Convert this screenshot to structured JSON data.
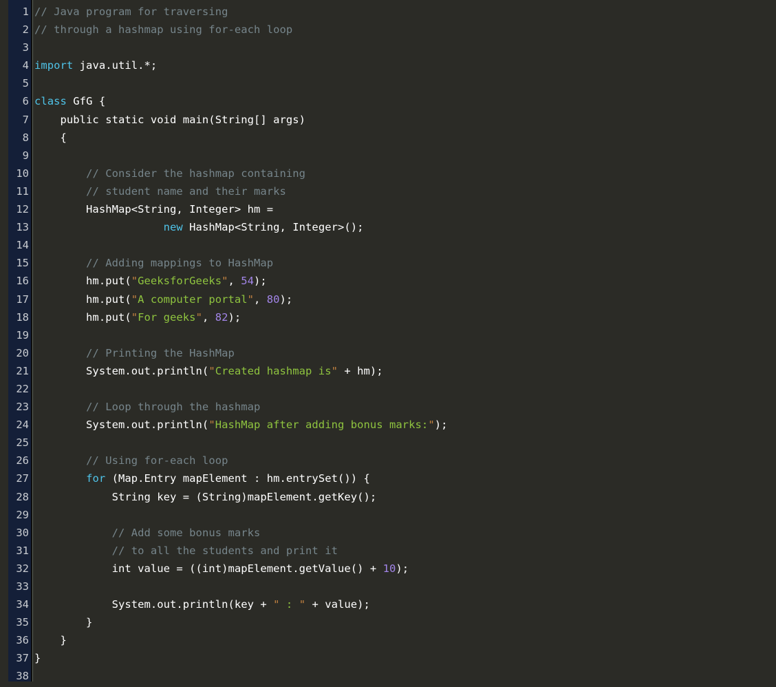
{
  "editor": {
    "language": "java",
    "total_lines": 38,
    "theme": {
      "background": "#2b2b26",
      "gutter_background": "#141f38",
      "gutter_text": "#c9ccd1",
      "plain_text": "#ffffff",
      "comment": "#76858b",
      "keyword": "#4fc3e8",
      "string": "#8fc43f",
      "quote": "#c08040",
      "number": "#a285e8"
    }
  },
  "lines": [
    {
      "n": "1",
      "tokens": [
        {
          "t": "// Java program for traversing",
          "c": "cm"
        }
      ]
    },
    {
      "n": "2",
      "tokens": [
        {
          "t": "// through a hashmap using for-each loop",
          "c": "cm"
        }
      ]
    },
    {
      "n": "3",
      "tokens": []
    },
    {
      "n": "4",
      "tokens": [
        {
          "t": "import",
          "c": "kw"
        },
        {
          "t": " java.util.*;",
          "c": "pl"
        }
      ]
    },
    {
      "n": "5",
      "tokens": []
    },
    {
      "n": "6",
      "tokens": [
        {
          "t": "class",
          "c": "kw"
        },
        {
          "t": " GfG {",
          "c": "pl"
        }
      ]
    },
    {
      "n": "7",
      "tokens": [
        {
          "t": "    public static void main(String[] args)",
          "c": "pl"
        }
      ]
    },
    {
      "n": "8",
      "tokens": [
        {
          "t": "    {",
          "c": "pl"
        }
      ]
    },
    {
      "n": "9",
      "tokens": []
    },
    {
      "n": "10",
      "tokens": [
        {
          "t": "        ",
          "c": "pl"
        },
        {
          "t": "// Consider the hashmap containing",
          "c": "cm"
        }
      ]
    },
    {
      "n": "11",
      "tokens": [
        {
          "t": "        ",
          "c": "pl"
        },
        {
          "t": "// student name and their marks",
          "c": "cm"
        }
      ]
    },
    {
      "n": "12",
      "tokens": [
        {
          "t": "        HashMap<String, Integer> hm =",
          "c": "pl"
        }
      ]
    },
    {
      "n": "13",
      "tokens": [
        {
          "t": "                    ",
          "c": "pl"
        },
        {
          "t": "new",
          "c": "kw"
        },
        {
          "t": " HashMap<String, Integer>();",
          "c": "pl"
        }
      ]
    },
    {
      "n": "14",
      "tokens": []
    },
    {
      "n": "15",
      "tokens": [
        {
          "t": "        ",
          "c": "pl"
        },
        {
          "t": "// Adding mappings to HashMap",
          "c": "cm"
        }
      ]
    },
    {
      "n": "16",
      "tokens": [
        {
          "t": "        hm.put(",
          "c": "pl"
        },
        {
          "t": "\"",
          "c": "qt"
        },
        {
          "t": "GeeksforGeeks",
          "c": "st"
        },
        {
          "t": "\"",
          "c": "qt"
        },
        {
          "t": ", ",
          "c": "pl"
        },
        {
          "t": "54",
          "c": "nm"
        },
        {
          "t": ");",
          "c": "pl"
        }
      ]
    },
    {
      "n": "17",
      "tokens": [
        {
          "t": "        hm.put(",
          "c": "pl"
        },
        {
          "t": "\"",
          "c": "qt"
        },
        {
          "t": "A computer portal",
          "c": "st"
        },
        {
          "t": "\"",
          "c": "qt"
        },
        {
          "t": ", ",
          "c": "pl"
        },
        {
          "t": "80",
          "c": "nm"
        },
        {
          "t": ");",
          "c": "pl"
        }
      ]
    },
    {
      "n": "18",
      "tokens": [
        {
          "t": "        hm.put(",
          "c": "pl"
        },
        {
          "t": "\"",
          "c": "qt"
        },
        {
          "t": "For geeks",
          "c": "st"
        },
        {
          "t": "\"",
          "c": "qt"
        },
        {
          "t": ", ",
          "c": "pl"
        },
        {
          "t": "82",
          "c": "nm"
        },
        {
          "t": ");",
          "c": "pl"
        }
      ]
    },
    {
      "n": "19",
      "tokens": []
    },
    {
      "n": "20",
      "tokens": [
        {
          "t": "        ",
          "c": "pl"
        },
        {
          "t": "// Printing the HashMap",
          "c": "cm"
        }
      ]
    },
    {
      "n": "21",
      "tokens": [
        {
          "t": "        System.out.println(",
          "c": "pl"
        },
        {
          "t": "\"",
          "c": "qt"
        },
        {
          "t": "Created hashmap is",
          "c": "st"
        },
        {
          "t": "\"",
          "c": "qt"
        },
        {
          "t": " + hm);",
          "c": "pl"
        }
      ]
    },
    {
      "n": "22",
      "tokens": []
    },
    {
      "n": "23",
      "tokens": [
        {
          "t": "        ",
          "c": "pl"
        },
        {
          "t": "// Loop through the hashmap",
          "c": "cm"
        }
      ]
    },
    {
      "n": "24",
      "tokens": [
        {
          "t": "        System.out.println(",
          "c": "pl"
        },
        {
          "t": "\"",
          "c": "qt"
        },
        {
          "t": "HashMap after adding bonus marks:",
          "c": "st"
        },
        {
          "t": "\"",
          "c": "qt"
        },
        {
          "t": ");",
          "c": "pl"
        }
      ]
    },
    {
      "n": "25",
      "tokens": []
    },
    {
      "n": "26",
      "tokens": [
        {
          "t": "        ",
          "c": "pl"
        },
        {
          "t": "// Using for-each loop",
          "c": "cm"
        }
      ]
    },
    {
      "n": "27",
      "tokens": [
        {
          "t": "        ",
          "c": "pl"
        },
        {
          "t": "for",
          "c": "kw"
        },
        {
          "t": " (Map.Entry mapElement : hm.entrySet()) {",
          "c": "pl"
        }
      ]
    },
    {
      "n": "28",
      "tokens": [
        {
          "t": "            String key = (String)mapElement.getKey();",
          "c": "pl"
        }
      ]
    },
    {
      "n": "29",
      "tokens": []
    },
    {
      "n": "30",
      "tokens": [
        {
          "t": "            ",
          "c": "pl"
        },
        {
          "t": "// Add some bonus marks",
          "c": "cm"
        }
      ]
    },
    {
      "n": "31",
      "tokens": [
        {
          "t": "            ",
          "c": "pl"
        },
        {
          "t": "// to all the students and print it",
          "c": "cm"
        }
      ]
    },
    {
      "n": "32",
      "tokens": [
        {
          "t": "            int value = ((int)mapElement.getValue() + ",
          "c": "pl"
        },
        {
          "t": "10",
          "c": "nm"
        },
        {
          "t": ");",
          "c": "pl"
        }
      ]
    },
    {
      "n": "33",
      "tokens": []
    },
    {
      "n": "34",
      "tokens": [
        {
          "t": "            System.out.println(key + ",
          "c": "pl"
        },
        {
          "t": "\"",
          "c": "qt"
        },
        {
          "t": " : ",
          "c": "st"
        },
        {
          "t": "\"",
          "c": "qt"
        },
        {
          "t": " + value);",
          "c": "pl"
        }
      ]
    },
    {
      "n": "35",
      "tokens": [
        {
          "t": "        }",
          "c": "pl"
        }
      ]
    },
    {
      "n": "36",
      "tokens": [
        {
          "t": "    }",
          "c": "pl"
        }
      ]
    },
    {
      "n": "37",
      "tokens": [
        {
          "t": "}",
          "c": "pl"
        }
      ]
    },
    {
      "n": "38",
      "tokens": []
    }
  ]
}
